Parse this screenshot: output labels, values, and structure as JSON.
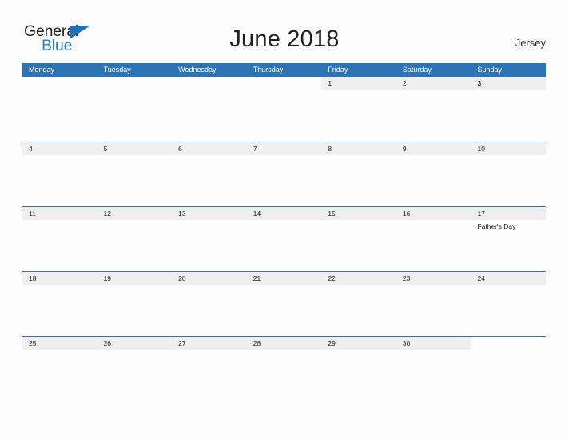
{
  "brand": {
    "name_part1": "General",
    "name_part2": "Blue",
    "flag_icon": "blue-triangle-flag",
    "color_dark": "#231f20",
    "color_blue": "#2980c4"
  },
  "header": {
    "title": "June 2018",
    "region": "Jersey"
  },
  "theme": {
    "header_blue": "#2e74b5",
    "row_border_blue": "#2e74b5",
    "date_band_gray": "#efefef",
    "page_background": "#fdfdfd",
    "text_dark": "#1c1c1c",
    "weekday_text": "#ffffff"
  },
  "calendar": {
    "month": "June",
    "year": "2018",
    "weekday_headers": [
      "Monday",
      "Tuesday",
      "Wednesday",
      "Thursday",
      "Friday",
      "Saturday",
      "Sunday"
    ],
    "weeks": [
      [
        {
          "day": "",
          "events": []
        },
        {
          "day": "",
          "events": []
        },
        {
          "day": "",
          "events": []
        },
        {
          "day": "",
          "events": []
        },
        {
          "day": "1",
          "events": []
        },
        {
          "day": "2",
          "events": []
        },
        {
          "day": "3",
          "events": []
        }
      ],
      [
        {
          "day": "4",
          "events": []
        },
        {
          "day": "5",
          "events": []
        },
        {
          "day": "6",
          "events": []
        },
        {
          "day": "7",
          "events": []
        },
        {
          "day": "8",
          "events": []
        },
        {
          "day": "9",
          "events": []
        },
        {
          "day": "10",
          "events": []
        }
      ],
      [
        {
          "day": "11",
          "events": []
        },
        {
          "day": "12",
          "events": []
        },
        {
          "day": "13",
          "events": []
        },
        {
          "day": "14",
          "events": []
        },
        {
          "day": "15",
          "events": []
        },
        {
          "day": "16",
          "events": []
        },
        {
          "day": "17",
          "events": [
            "Father's Day"
          ]
        }
      ],
      [
        {
          "day": "18",
          "events": []
        },
        {
          "day": "19",
          "events": []
        },
        {
          "day": "20",
          "events": []
        },
        {
          "day": "21",
          "events": []
        },
        {
          "day": "22",
          "events": []
        },
        {
          "day": "23",
          "events": []
        },
        {
          "day": "24",
          "events": []
        }
      ],
      [
        {
          "day": "25",
          "events": []
        },
        {
          "day": "26",
          "events": []
        },
        {
          "day": "27",
          "events": []
        },
        {
          "day": "28",
          "events": []
        },
        {
          "day": "29",
          "events": []
        },
        {
          "day": "30",
          "events": []
        },
        {
          "day": "",
          "events": []
        }
      ]
    ]
  }
}
